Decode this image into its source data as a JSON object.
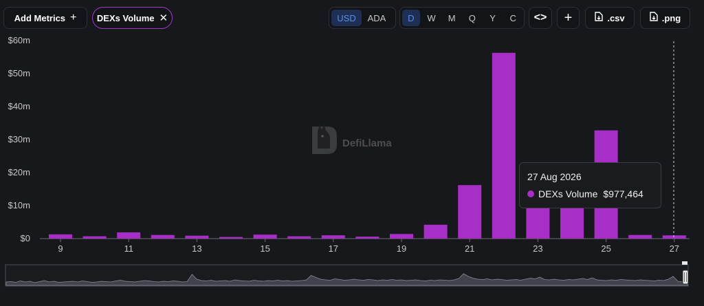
{
  "toolbar": {
    "add_metrics_label": "Add Metrics",
    "metric_chip_label": "DEXs Volume",
    "currency_options": [
      "USD",
      "ADA"
    ],
    "currency_selected": "USD",
    "interval_options": [
      "D",
      "W",
      "M",
      "Q",
      "Y",
      "C"
    ],
    "interval_selected": "D",
    "csv_label": ".csv",
    "png_label": ".png"
  },
  "watermark": {
    "text": "DefiLlama"
  },
  "tooltip": {
    "date": "27 Aug 2026",
    "series": "DEXs Volume",
    "value": "$977,464"
  },
  "colors": {
    "bar": "#a72fc7",
    "accent_chip_border": "#a238c8",
    "selected": "#5b8ee6",
    "background": "#17181c"
  },
  "chart_data": {
    "type": "bar",
    "x": [
      9,
      10,
      11,
      12,
      13,
      14,
      15,
      16,
      17,
      18,
      19,
      20,
      21,
      22,
      23,
      24,
      25,
      26,
      27
    ],
    "x_tick_labels": [
      "9",
      "11",
      "13",
      "15",
      "17",
      "19",
      "21",
      "23",
      "25",
      "27"
    ],
    "y_tick_labels": [
      "$0",
      "$10m",
      "$20m",
      "$30m",
      "$40m",
      "$50m",
      "$60m"
    ],
    "ylim": [
      0,
      60
    ],
    "y_unit": "$m",
    "series": [
      {
        "name": "DEXs Volume",
        "values": [
          1.3,
          0.7,
          1.9,
          1.1,
          0.9,
          0.5,
          1.2,
          0.7,
          1.0,
          0.6,
          1.4,
          4.2,
          16.2,
          56.3,
          10.0,
          9.5,
          32.8,
          1.1,
          0.98
        ]
      }
    ],
    "overview_series": [
      1.0,
      1.1,
      0.9,
      1.3,
      1.0,
      1.2,
      0.8,
      1.1,
      1.4,
      1.0,
      1.2,
      0.9,
      1.0,
      1.1,
      1.2,
      1.0,
      1.3,
      1.1,
      0.9,
      1.0,
      1.2,
      1.1,
      1.0,
      1.3,
      1.5,
      1.2,
      1.1,
      1.0,
      1.2,
      1.4,
      1.3,
      1.1,
      1.0,
      1.2,
      1.1,
      1.3,
      1.2,
      1.0,
      1.1,
      3.2,
      1.8,
      1.4,
      1.3,
      1.5,
      1.2,
      1.3,
      1.4,
      1.2,
      1.6,
      1.4,
      1.3,
      1.2,
      1.5,
      1.3,
      1.2,
      1.4,
      1.3,
      1.5,
      1.3,
      1.4,
      1.2,
      1.3,
      1.4,
      1.6,
      2.9,
      2.3,
      1.8,
      1.6,
      1.5,
      1.9,
      1.7,
      1.5,
      1.6,
      1.8,
      1.6,
      1.5,
      1.7,
      1.6,
      1.4,
      1.6,
      1.5,
      1.7,
      1.5,
      1.6,
      1.4,
      1.5,
      1.6,
      1.4,
      1.3,
      1.5,
      1.4,
      1.6,
      1.5,
      1.4,
      1.6,
      2.0,
      3.4,
      2.6,
      2.1,
      1.8,
      1.7,
      1.9,
      1.6,
      1.8,
      1.7,
      1.5,
      1.6,
      1.7,
      1.5,
      1.8,
      2.1,
      1.9,
      2.4,
      1.7,
      1.6,
      1.8,
      1.6,
      1.5,
      1.7,
      1.6,
      1.8,
      2.0,
      1.7,
      2.2,
      1.6,
      1.5,
      1.4,
      1.6,
      1.5,
      1.7,
      1.6,
      1.5,
      1.4,
      1.6,
      1.5,
      1.4,
      1.3,
      1.5,
      1.4,
      1.8,
      2.6,
      1.2,
      1.0,
      3.5
    ]
  }
}
